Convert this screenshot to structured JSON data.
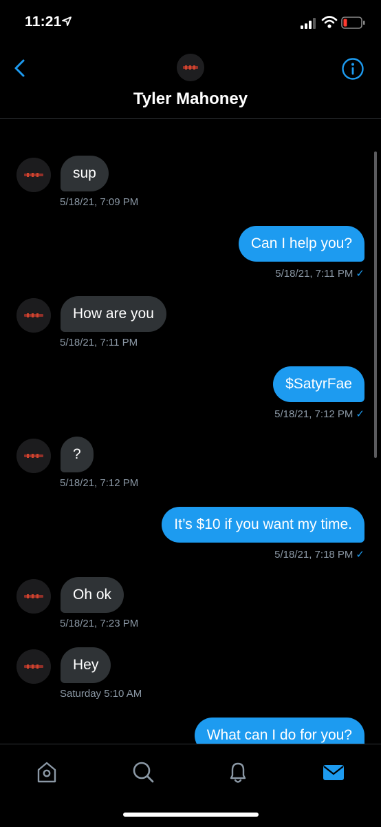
{
  "status_bar": {
    "time": "11:21"
  },
  "header": {
    "title": "Tyler Mahoney"
  },
  "messages": [
    {
      "dir": "in",
      "text": "sup",
      "time": "5/18/21, 7:09 PM"
    },
    {
      "dir": "out",
      "text": "Can I help you?",
      "time": "5/18/21, 7:11 PM"
    },
    {
      "dir": "in",
      "text": "How are you",
      "time": "5/18/21, 7:11 PM"
    },
    {
      "dir": "out",
      "text": "$SatyrFae",
      "time": "5/18/21, 7:12 PM"
    },
    {
      "dir": "in",
      "text": "?",
      "time": "5/18/21, 7:12 PM"
    },
    {
      "dir": "out",
      "text": "It’s $10 if you want my time.",
      "time": "5/18/21, 7:18 PM"
    },
    {
      "dir": "in",
      "text": "Oh ok",
      "time": "5/18/21, 7:23 PM"
    },
    {
      "dir": "in",
      "text": "Hey",
      "time": "Saturday 5:10 AM"
    },
    {
      "dir": "out",
      "text": "What can I do for you?"
    }
  ],
  "read_mark": "✓",
  "tabbar": {
    "icons": [
      "home-icon",
      "search-icon",
      "notifications-icon",
      "messages-icon"
    ],
    "active": "messages-icon"
  },
  "colors": {
    "accent": "#1d9bf0",
    "incoming_bubble": "#2f3336",
    "timestamp": "#8b98a5",
    "background": "#000000"
  }
}
